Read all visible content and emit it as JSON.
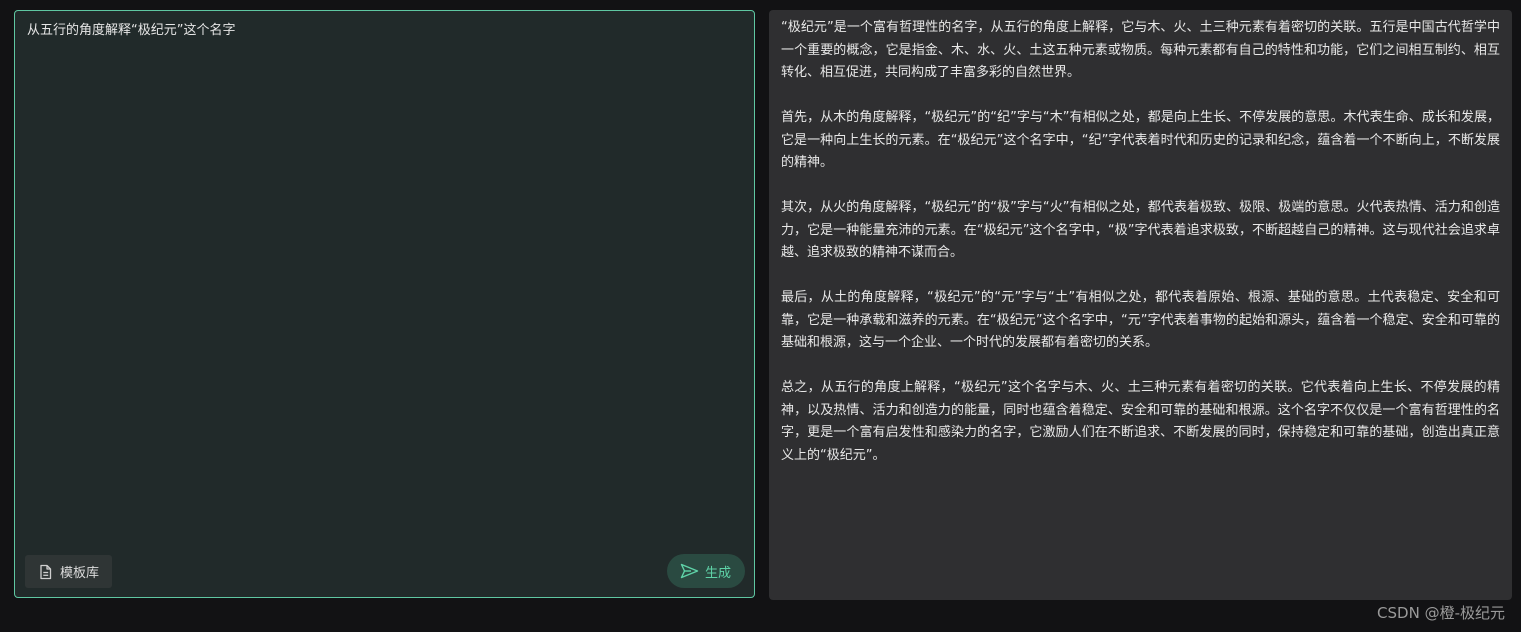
{
  "input": {
    "text": "从五行的角度解释“极纪元”这个名字"
  },
  "buttons": {
    "template_label": "模板库",
    "template_icon": "document-icon",
    "generate_label": "生成",
    "generate_icon": "send-icon"
  },
  "output": {
    "paragraphs": [
      "“极纪元”是一个富有哲理性的名字，从五行的角度上解释，它与木、火、土三种元素有着密切的关联。五行是中国古代哲学中一个重要的概念，它是指金、木、水、火、土这五种元素或物质。每种元素都有自己的特性和功能，它们之间相互制约、相互转化、相互促进，共同构成了丰富多彩的自然世界。",
      "首先，从木的角度解释，“极纪元”的“纪”字与“木”有相似之处，都是向上生长、不停发展的意思。木代表生命、成长和发展，它是一种向上生长的元素。在“极纪元”这个名字中，“纪”字代表着时代和历史的记录和纪念，蕴含着一个不断向上，不断发展的精神。",
      "其次，从火的角度解释，“极纪元”的“极”字与“火”有相似之处，都代表着极致、极限、极端的意思。火代表热情、活力和创造力，它是一种能量充沛的元素。在“极纪元”这个名字中，“极”字代表着追求极致，不断超越自己的精神。这与现代社会追求卓越、追求极致的精神不谋而合。",
      "最后，从土的角度解释，“极纪元”的“元”字与“土”有相似之处，都代表着原始、根源、基础的意思。土代表稳定、安全和可靠，它是一种承载和滋养的元素。在“极纪元”这个名字中，“元”字代表着事物的起始和源头，蕴含着一个稳定、安全和可靠的基础和根源，这与一个企业、一个时代的发展都有着密切的关系。",
      "总之，从五行的角度上解释，“极纪元”这个名字与木、火、土三种元素有着密切的关联。它代表着向上生长、不停发展的精神，以及热情、活力和创造力的能量，同时也蕴含着稳定、安全和可靠的基础和根源。这个名字不仅仅是一个富有哲理性的名字，更是一个富有启发性和感染力的名字，它激励人们在不断追求、不断发展的同时，保持稳定和可靠的基础，创造出真正意义上的“极纪元”。"
    ]
  },
  "watermark": "CSDN @橙-极纪元",
  "colors": {
    "accent": "#5fd3a8",
    "input_border": "#5fc7a2",
    "input_bg": "#212a2a",
    "output_bg": "#2f2f31",
    "page_bg": "#121214"
  }
}
